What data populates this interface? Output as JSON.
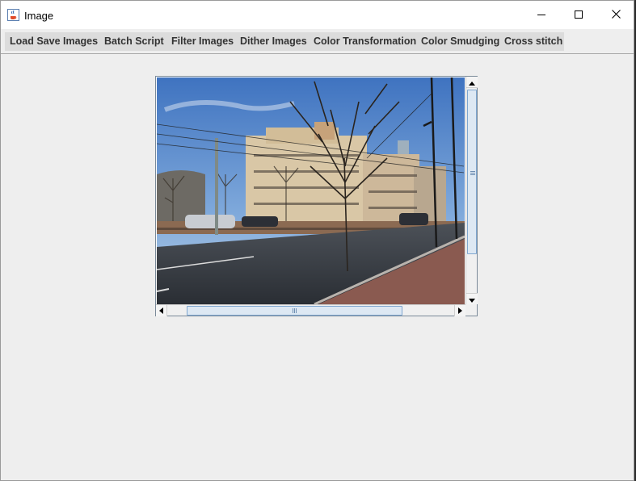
{
  "window": {
    "title": "Image",
    "app_icon": "java-cup-icon",
    "controls": [
      "minimize-icon",
      "maximize-icon",
      "close-icon"
    ]
  },
  "menu": {
    "items": [
      {
        "label": "Load Save Images"
      },
      {
        "label": "Batch Script"
      },
      {
        "label": "Filter Images"
      },
      {
        "label": "Dither Images"
      },
      {
        "label": "Color Transformation"
      },
      {
        "label": "Color Smudging"
      },
      {
        "label": "Cross stitch"
      }
    ]
  },
  "image_view": {
    "subject": "street photo",
    "scrollbars": {
      "vertical_thumb_fraction": 0.78,
      "vertical_position": 0.0,
      "horizontal_thumb_fraction": 0.75,
      "horizontal_position": 0.12
    }
  },
  "colors": {
    "titlebar_bg": "#ffffff",
    "window_bg": "#eeeeee",
    "menu_strip_bg": "#dcdcdc",
    "scroll_thumb": "#dde8f3",
    "scroll_thumb_border": "#7ea6cf"
  }
}
